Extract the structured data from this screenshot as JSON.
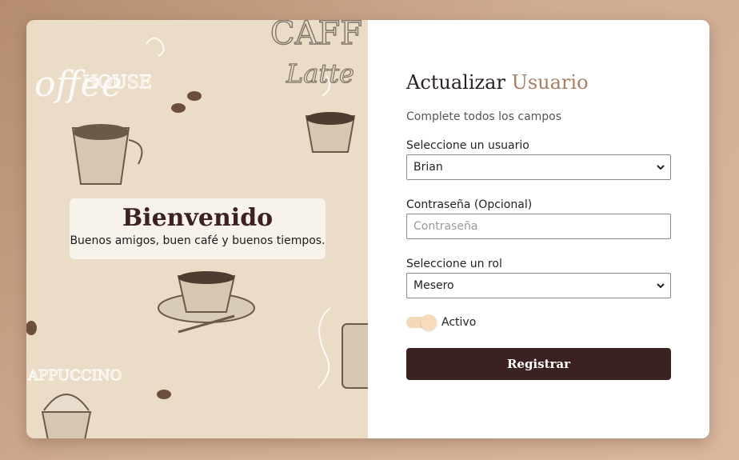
{
  "welcome": {
    "title": "Bienvenido",
    "tagline": "Buenos amigos, buen café y buenos tiempos."
  },
  "background_text": [
    "offee",
    "HOUSE",
    "CAFF",
    "Latte",
    "APPUCCINO"
  ],
  "form": {
    "title_main": "Actualizar",
    "title_accent": "Usuario",
    "subtitle": "Complete todos los campos",
    "user_label": "Seleccione un usuario",
    "user_value": "Brian",
    "password_label": "Contraseña (Opcional)",
    "password_placeholder": "Contraseña",
    "role_label": "Seleccione un rol",
    "role_value": "Mesero",
    "active_label": "Activo",
    "active_on": true,
    "submit_label": "Registrar"
  },
  "colors": {
    "accent": "#a77e63",
    "button": "#3b2220",
    "toggle": "#f3d9b8"
  }
}
